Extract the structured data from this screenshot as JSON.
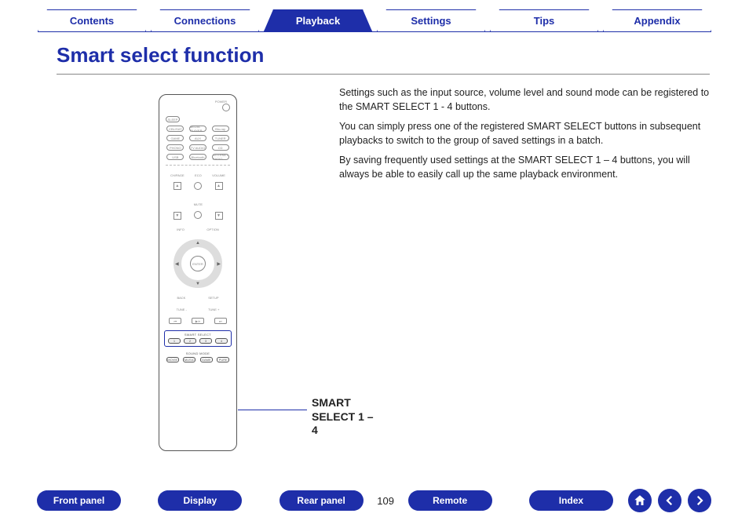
{
  "topnav": {
    "tabs": [
      {
        "label": "Contents",
        "active": false
      },
      {
        "label": "Connections",
        "active": false
      },
      {
        "label": "Playback",
        "active": true
      },
      {
        "label": "Settings",
        "active": false
      },
      {
        "label": "Tips",
        "active": false
      },
      {
        "label": "Appendix",
        "active": false
      }
    ]
  },
  "page": {
    "heading": "Smart select function",
    "number": "109"
  },
  "remote": {
    "power_label": "POWER",
    "sleep": "SLEEP",
    "sources_row1": [
      "CBL/SAT",
      "MEDIA PLAYER",
      "Blu-ray"
    ],
    "sources_row2": [
      "GAME",
      "AUX",
      "TUNER"
    ],
    "sources_row3": [
      "PHONO",
      "TV AUDIO",
      "CD"
    ],
    "sources_row4": [
      "USB",
      "Bluetooth",
      "INTERNET RADIO"
    ],
    "eco": "ECO",
    "ch_page": "CH/PAGE",
    "mute": "MUTE",
    "volume": "VOLUME",
    "info": "INFO",
    "option": "OPTION",
    "enter": "ENTER",
    "back": "BACK",
    "setup": "SETUP",
    "tune_minus": "TUNE -",
    "tune_plus": "TUNE +",
    "transport": [
      "⏮",
      "▶/⏸",
      "⏭"
    ],
    "smart_select_label": "SMART SELECT",
    "smart_select": [
      "1",
      "2",
      "3",
      "4"
    ],
    "sound_mode_label": "SOUND MODE",
    "sound_mode": [
      "MOVIE",
      "MUSIC",
      "GAME",
      "PURE"
    ]
  },
  "callout": {
    "label": "SMART SELECT 1 – 4"
  },
  "body_text": {
    "p1": "Settings such as the input source, volume level and sound mode can be registered to the SMART SELECT 1 - 4 buttons.",
    "p2": "You can simply press one of the registered SMART SELECT buttons in subsequent playbacks to switch to the group of saved settings in a batch.",
    "p3": "By saving frequently used settings at the SMART SELECT 1 – 4 buttons, you will always be able to easily call up the same playback environment."
  },
  "bottomnav": {
    "buttons_left": [
      "Front panel",
      "Display",
      "Rear panel"
    ],
    "buttons_right": [
      "Remote",
      "Index"
    ]
  },
  "icons": {
    "home": "home-icon",
    "prev": "arrow-left-icon",
    "next": "arrow-right-icon"
  }
}
